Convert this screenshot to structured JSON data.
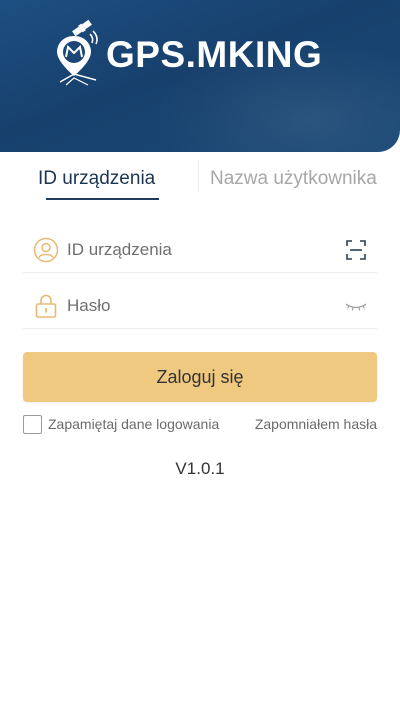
{
  "header": {
    "brand_text": "GPS.MKING",
    "logo_icon": "satellite-pin-logo",
    "background_color": "#17406d"
  },
  "tabs": [
    {
      "label": "ID urządzenia",
      "active": true
    },
    {
      "label": "Nazwa użytkownika",
      "active": false
    }
  ],
  "form": {
    "device_id": {
      "placeholder": "ID urządzenia",
      "value": "",
      "icon": "user-icon",
      "action_icon": "scan-icon"
    },
    "password": {
      "placeholder": "Hasło",
      "value": "",
      "icon": "lock-icon",
      "action_icon": "eye-closed-icon"
    }
  },
  "login_button": {
    "label": "Zaloguj się",
    "color": "#f0c980"
  },
  "remember": {
    "label": "Zapamiętaj dane logowania",
    "checked": false
  },
  "forgot_password": {
    "label": "Zapomniałem hasła"
  },
  "version": "V1.0.1",
  "accent_color": "#f0c980"
}
